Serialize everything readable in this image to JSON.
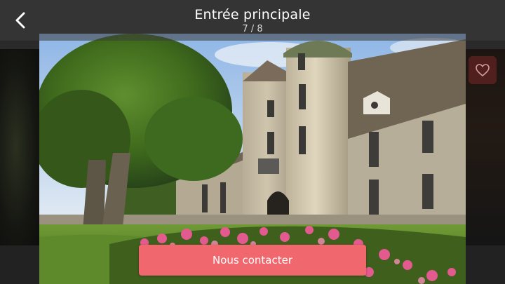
{
  "header": {
    "title": "Entrée principale",
    "counter": "7 / 8",
    "back_icon": "chevron-left-icon"
  },
  "background": {
    "heart_icon": "heart-icon"
  },
  "photo": {
    "subject": "château"
  },
  "cta": {
    "label": "Nous contacter",
    "color": "#f0676e"
  },
  "colors": {
    "header_bg": "#3c3c3c",
    "accent": "#f0676e"
  }
}
